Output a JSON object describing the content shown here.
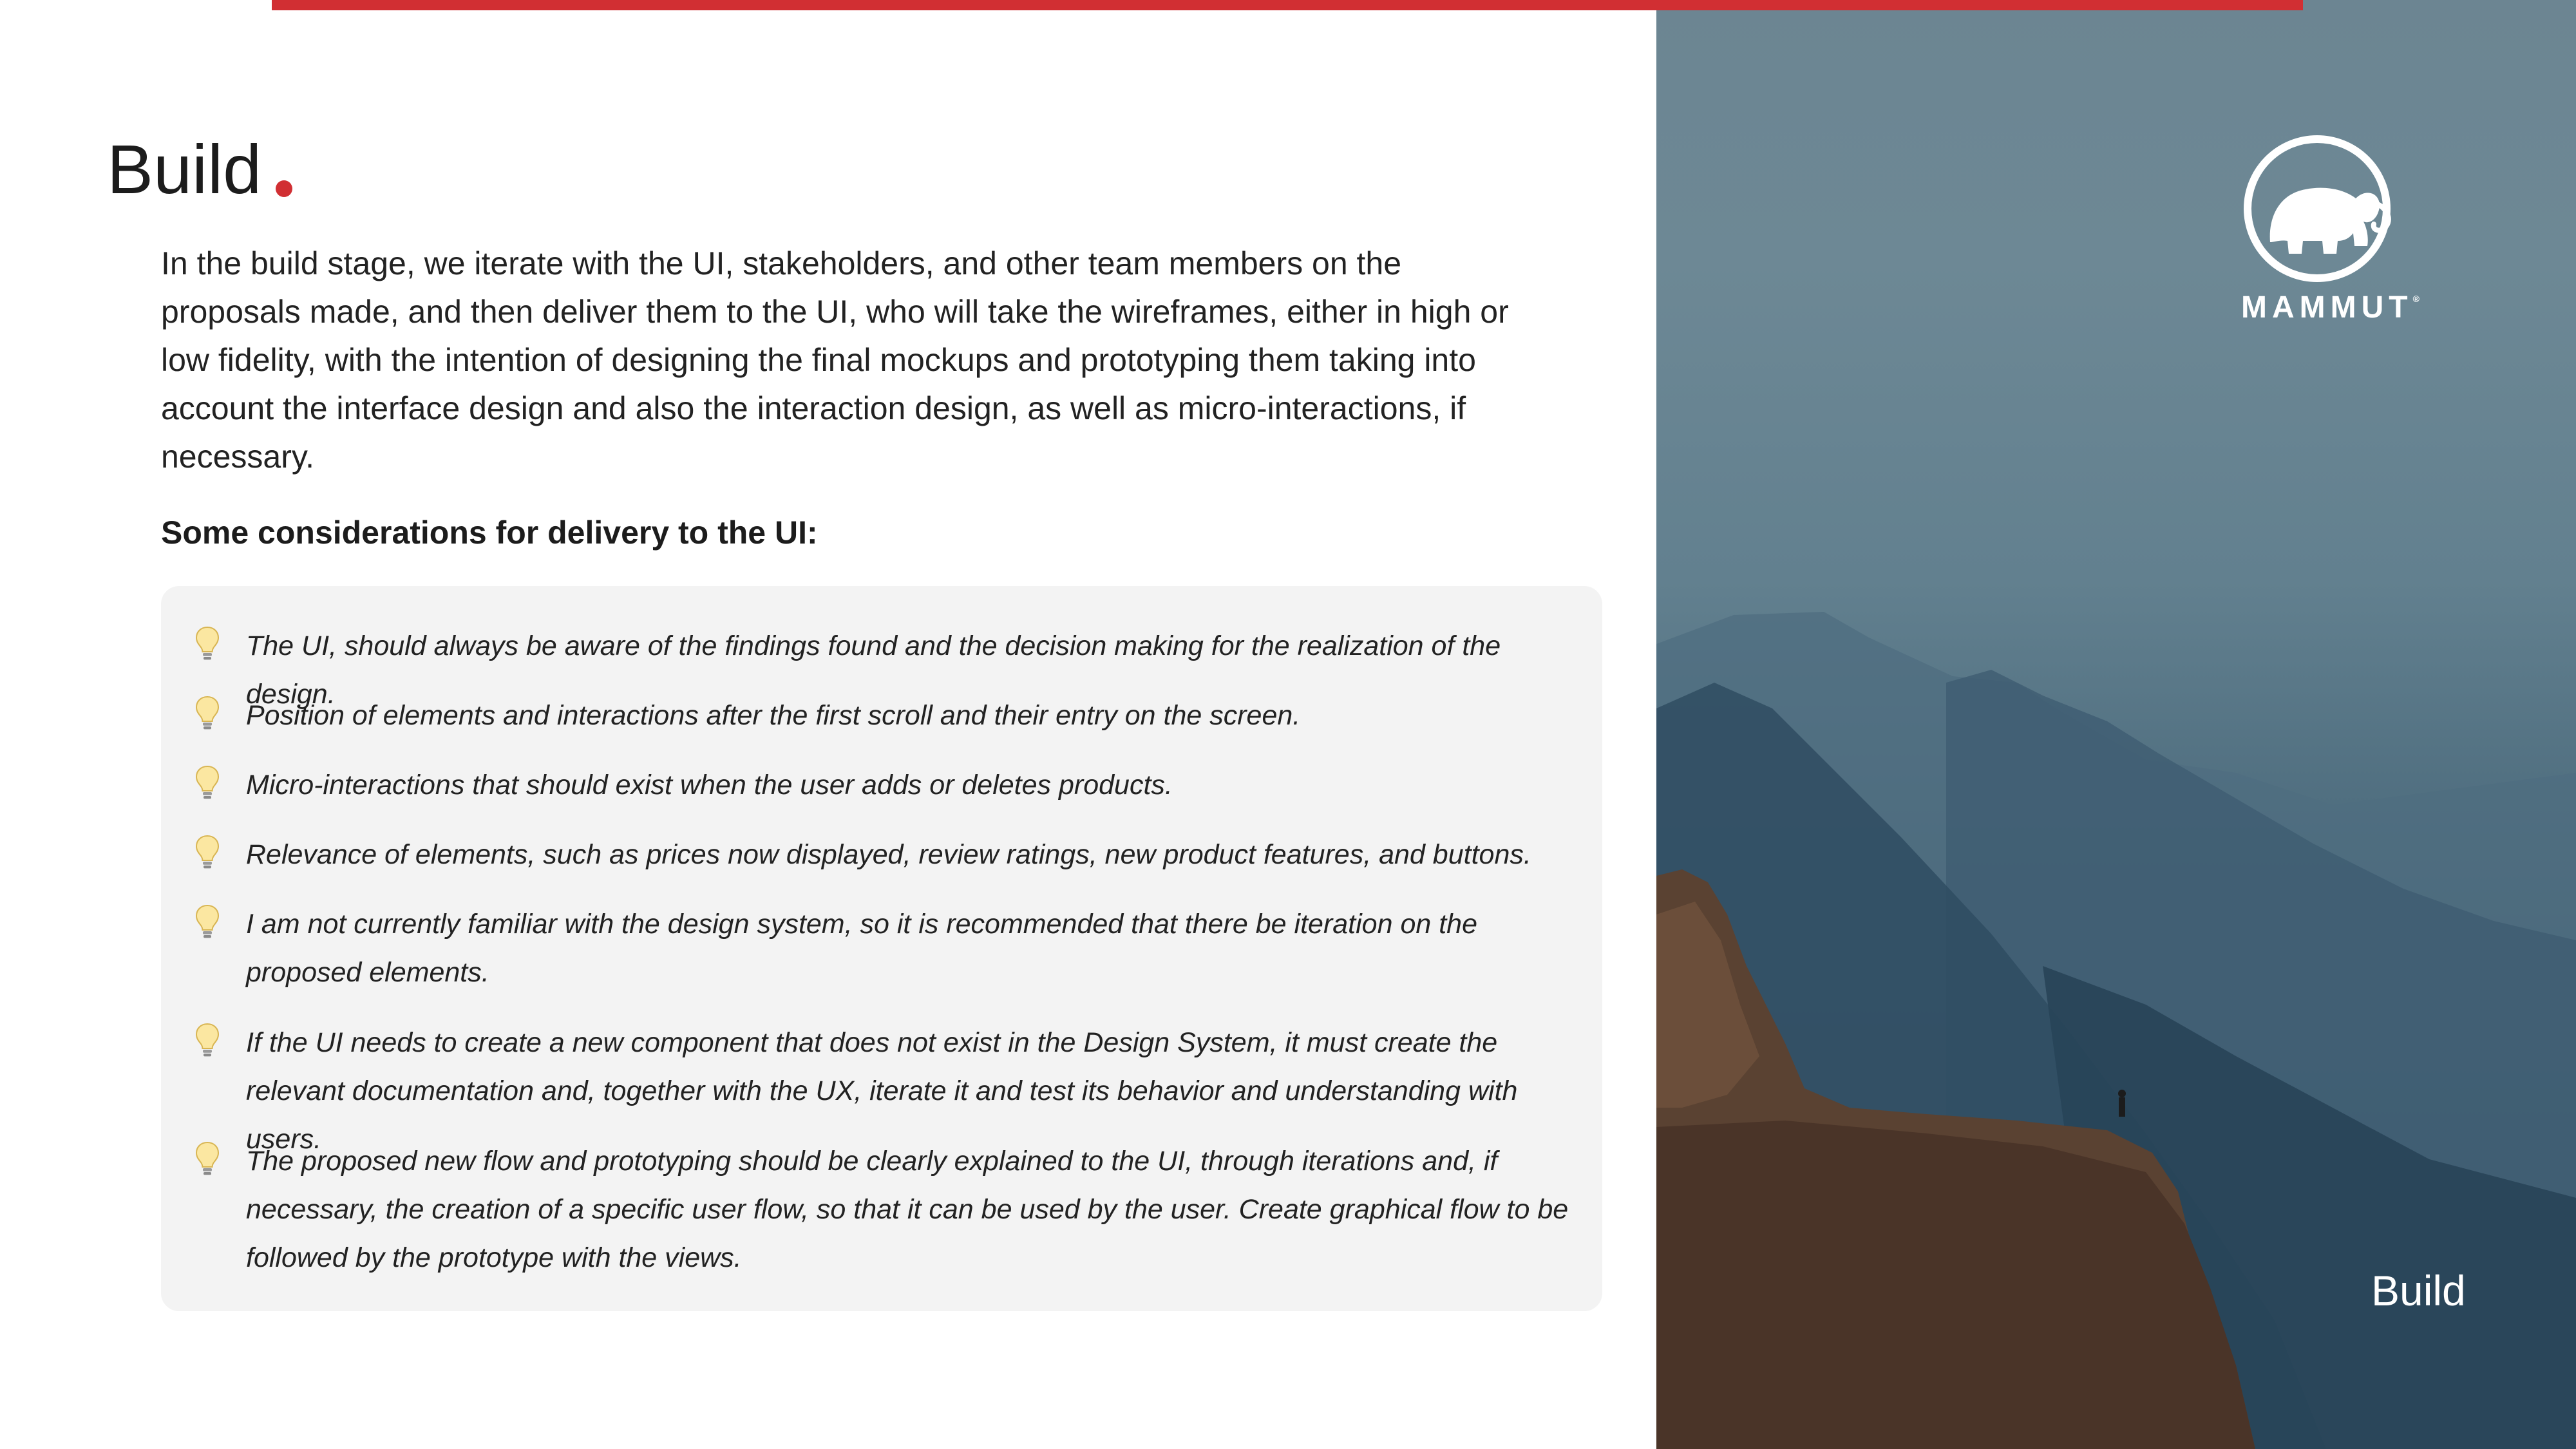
{
  "slide": {
    "title": "Build",
    "intro": "In the build stage, we iterate with the UI, stakeholders, and other team members on the proposals made, and then deliver them to the UI, who will take the wireframes, either in high or low fidelity, with the intention of designing the final mockups and prototyping them taking into account the interface design and also the interaction design, as well as micro-interactions, if necessary.",
    "subheading": "Some considerations for delivery to the UI:",
    "tip_icon": "lightbulb-icon",
    "tips": [
      "The UI, should always be aware of the findings found and the decision making for the realization of the design.",
      "Position of elements and interactions after the first scroll and their entry on the screen.",
      "Micro-interactions that should exist when the user adds or deletes products.",
      "Relevance of elements, such as prices now displayed, review ratings, new product features, and buttons.",
      "I am not currently familiar with the design system, so it is recommended that there be iteration on the proposed elements.",
      "If the UI needs to create a new component that does not exist in the Design System, it must create the relevant documentation and, together with the UX, iterate it and test its behavior and understanding with users.",
      "The proposed new flow and prototyping should be clearly explained to the UI, through iterations and, if necessary, the creation of a specific user flow, so that it can be used by the user. Create graphical flow to be followed by the prototype with the views."
    ]
  },
  "brand": {
    "name": "MAMMUT",
    "mark": "®",
    "logo_icon": "mammoth-logo-icon"
  },
  "photo": {
    "caption": "Build"
  },
  "colors": {
    "accent": "#d12f33",
    "card_bg": "#f3f3f3",
    "text": "#1f1f1f"
  }
}
